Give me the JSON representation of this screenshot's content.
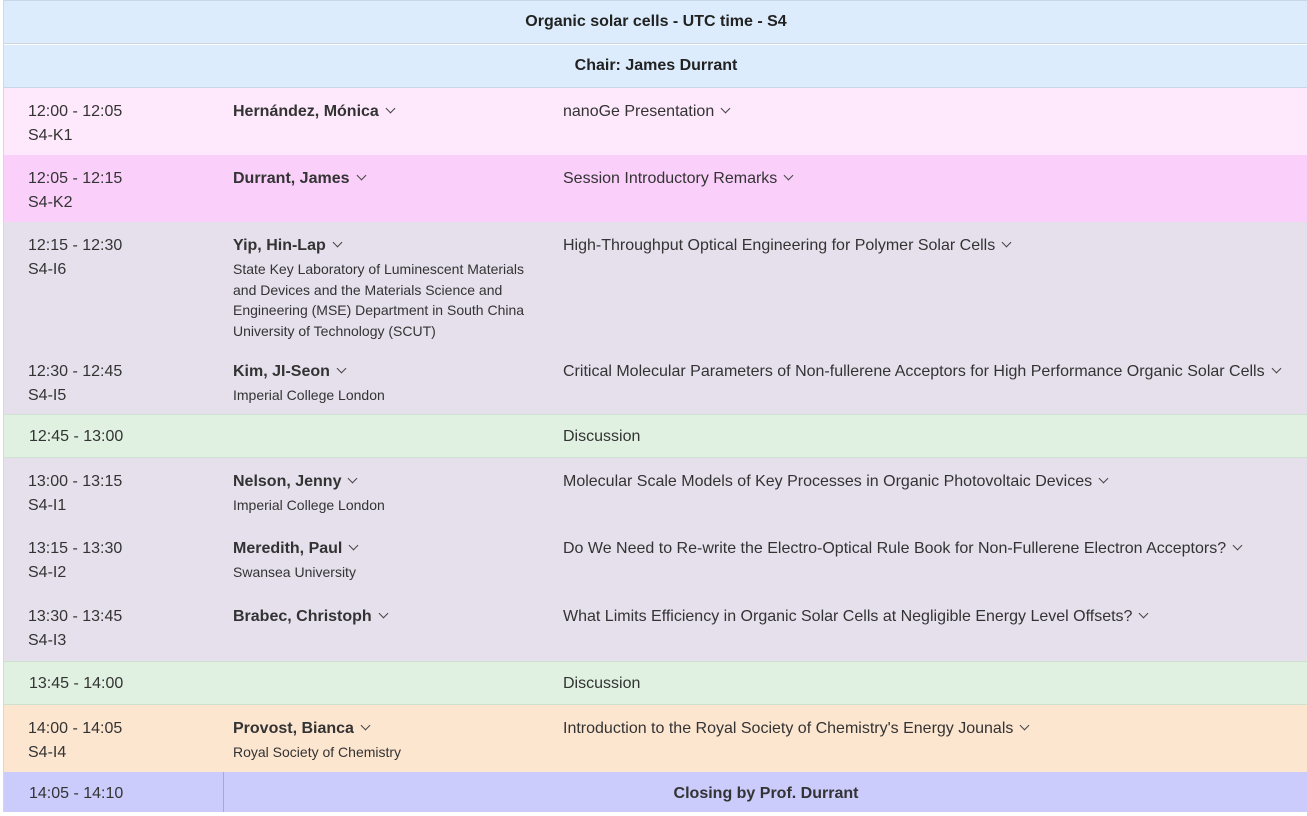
{
  "session": {
    "title": "Organic solar cells - UTC time - S4",
    "chair": "Chair: James Durrant"
  },
  "rows": [
    {
      "time": "12:00 - 12:05",
      "code": "S4-K1",
      "author": "Hernández, Mónica",
      "affiliation": "",
      "title": "nanoGe Presentation",
      "bg": "#fde9fb"
    },
    {
      "time": "12:05 - 12:15",
      "code": "S4-K2",
      "author": "Durrant, James",
      "affiliation": "",
      "title": "Session Introductory Remarks",
      "bg": "#fad0fa"
    },
    {
      "time": "12:15 - 12:30",
      "code": "S4-I6",
      "author": "Yip, Hin-Lap",
      "affiliation": "State Key Laboratory of Luminescent Materials and Devices and the Materials Science and Engineering (MSE) Department in South China University of Technology (SCUT)",
      "title": "High-Throughput Optical Engineering for Polymer Solar Cells",
      "bg": "#e6e0ec"
    },
    {
      "time": "12:30 - 12:45",
      "code": "S4-I5",
      "author": "Kim, JI-Seon",
      "affiliation": "Imperial College London",
      "title": "Critical Molecular Parameters of Non-fullerene Acceptors for High Performance Organic Solar Cells",
      "bg": "#e6e0ec"
    },
    {
      "discussion": true,
      "time": "12:45 - 13:00",
      "title": "Discussion"
    },
    {
      "time": "13:00 - 13:15",
      "code": "S4-I1",
      "author": "Nelson, Jenny",
      "affiliation": "Imperial College London",
      "title": "Molecular Scale Models of Key Processes in Organic Photovoltaic Devices",
      "bg": "#e6e0ec"
    },
    {
      "time": "13:15 - 13:30",
      "code": "S4-I2",
      "author": "Meredith, Paul",
      "affiliation": "Swansea University",
      "title": "Do We Need to Re-write the Electro-Optical Rule Book for Non-Fullerene Electron Acceptors?",
      "bg": "#e6e0ec"
    },
    {
      "time": "13:30 - 13:45",
      "code": "S4-I3",
      "author": "Brabec, Christoph",
      "affiliation": "",
      "title": "What Limits Efficiency in Organic Solar Cells at Negligible Energy Level Offsets?",
      "bg": "#e6e0ec"
    },
    {
      "discussion": true,
      "time": "13:45 - 14:00",
      "title": "Discussion"
    },
    {
      "time": "14:00 - 14:05",
      "code": "S4-I4",
      "author": "Provost, Bianca",
      "affiliation": "Royal Society of Chemistry",
      "title": "Introduction to the Royal Society of Chemistry's Energy Jounals",
      "bg": "#fde6d0"
    }
  ],
  "closing": {
    "time": "14:05 - 14:10",
    "text": "Closing by Prof. Durrant"
  }
}
